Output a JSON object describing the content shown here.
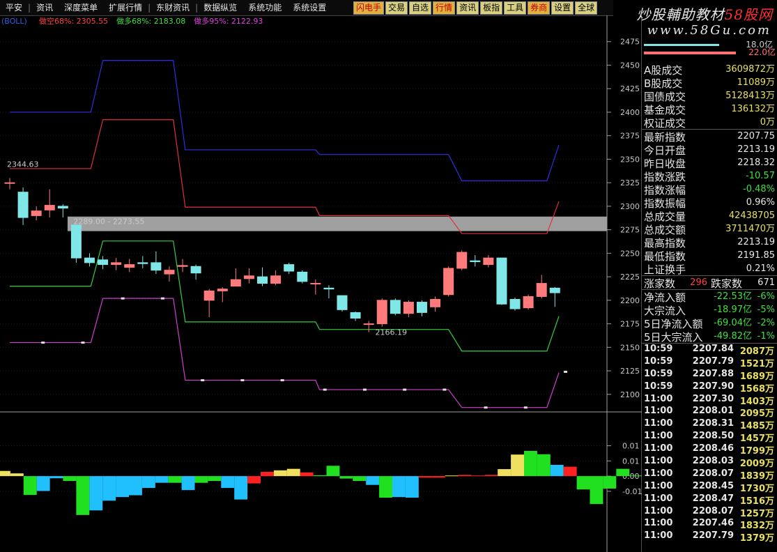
{
  "menu": {
    "items": [
      "平安",
      "资讯",
      "深度菜单",
      "扩展行情",
      "东财资讯",
      "数据纵览",
      "系统功能",
      "系统设置"
    ],
    "buttons": [
      "闪电手",
      "交易",
      "自选",
      "行情",
      "资讯",
      "板指",
      "工具",
      "券商",
      "设置",
      "全球"
    ]
  },
  "logo": {
    "line1_a": "炒股輔助教材",
    "line1_b": "58股网",
    "line2": "www.58Gu.com"
  },
  "legend": {
    "prefix": "(BOLL)",
    "items": [
      {
        "label": "做空68%: 2305.55",
        "color": "#ff4040"
      },
      {
        "label": "做多68%: 2183.08",
        "color": "#40e040"
      },
      {
        "label": "做多95%: 2122.93",
        "color": "#e040e0"
      }
    ]
  },
  "chart_data": [
    {
      "type": "candlestick",
      "title": "",
      "ylim": [
        2088,
        2500
      ],
      "yticks": [
        2100,
        2125,
        2150,
        2175,
        2200,
        2225,
        2250,
        2275,
        2300,
        2325,
        2350,
        2375,
        2400,
        2425,
        2450,
        2475
      ],
      "candles": [
        {
          "o": 2325,
          "c": 2325,
          "h": 2330,
          "l": 2318
        },
        {
          "o": 2315,
          "c": 2288,
          "h": 2320,
          "l": 2280
        },
        {
          "o": 2290,
          "c": 2295,
          "h": 2300,
          "l": 2285
        },
        {
          "o": 2296,
          "c": 2301,
          "h": 2318,
          "l": 2288
        },
        {
          "o": 2300,
          "c": 2298,
          "h": 2302,
          "l": 2288
        },
        {
          "o": 2280,
          "c": 2245,
          "h": 2280,
          "l": 2240
        },
        {
          "o": 2245,
          "c": 2240,
          "h": 2250,
          "l": 2236
        },
        {
          "o": 2243,
          "c": 2238,
          "h": 2247,
          "l": 2233
        },
        {
          "o": 2238,
          "c": 2240,
          "h": 2245,
          "l": 2232
        },
        {
          "o": 2235,
          "c": 2238,
          "h": 2244,
          "l": 2230
        },
        {
          "o": 2240,
          "c": 2239,
          "h": 2247,
          "l": 2234
        },
        {
          "o": 2240,
          "c": 2232,
          "h": 2252,
          "l": 2228
        },
        {
          "o": 2228,
          "c": 2232,
          "h": 2236,
          "l": 2220
        },
        {
          "o": 2236,
          "c": 2237,
          "h": 2244,
          "l": 2230
        },
        {
          "o": 2236,
          "c": 2229,
          "h": 2238,
          "l": 2222
        },
        {
          "o": 2200,
          "c": 2210,
          "h": 2212,
          "l": 2182
        },
        {
          "o": 2210,
          "c": 2212,
          "h": 2214,
          "l": 2198
        },
        {
          "o": 2215,
          "c": 2222,
          "h": 2234,
          "l": 2215
        },
        {
          "o": 2223,
          "c": 2226,
          "h": 2234,
          "l": 2218
        },
        {
          "o": 2225,
          "c": 2218,
          "h": 2235,
          "l": 2215
        },
        {
          "o": 2218,
          "c": 2226,
          "h": 2232,
          "l": 2216
        },
        {
          "o": 2238,
          "c": 2231,
          "h": 2240,
          "l": 2228
        },
        {
          "o": 2230,
          "c": 2220,
          "h": 2232,
          "l": 2218
        },
        {
          "o": 2218,
          "c": 2218,
          "h": 2222,
          "l": 2206
        },
        {
          "o": 2213,
          "c": 2212,
          "h": 2216,
          "l": 2202
        },
        {
          "o": 2205,
          "c": 2190,
          "h": 2205,
          "l": 2188
        },
        {
          "o": 2187,
          "c": 2181,
          "h": 2188,
          "l": 2178
        },
        {
          "o": 2175,
          "c": 2175,
          "h": 2178,
          "l": 2166
        },
        {
          "o": 2175,
          "c": 2200,
          "h": 2202,
          "l": 2172
        },
        {
          "o": 2200,
          "c": 2186,
          "h": 2202,
          "l": 2184
        },
        {
          "o": 2186,
          "c": 2198,
          "h": 2200,
          "l": 2182
        },
        {
          "o": 2198,
          "c": 2187,
          "h": 2200,
          "l": 2183
        },
        {
          "o": 2193,
          "c": 2201,
          "h": 2204,
          "l": 2188
        },
        {
          "o": 2206,
          "c": 2234,
          "h": 2236,
          "l": 2204
        },
        {
          "o": 2234,
          "c": 2251,
          "h": 2253,
          "l": 2232
        },
        {
          "o": 2242,
          "c": 2241,
          "h": 2248,
          "l": 2236
        },
        {
          "o": 2238,
          "c": 2245,
          "h": 2248,
          "l": 2235
        },
        {
          "o": 2245,
          "c": 2196,
          "h": 2245,
          "l": 2195
        },
        {
          "o": 2201,
          "c": 2191,
          "h": 2203,
          "l": 2189
        },
        {
          "o": 2192,
          "c": 2204,
          "h": 2206,
          "l": 2190
        },
        {
          "o": 2204,
          "c": 2218,
          "h": 2227,
          "l": 2202
        },
        {
          "o": 2213,
          "c": 2208,
          "h": 2214,
          "l": 2193
        }
      ],
      "lines": [
        {
          "name": "做空95%",
          "color": "#3030e0",
          "x": [
            0,
            6.1,
            7,
            12.3,
            13.2,
            23,
            23.3,
            33,
            34,
            40.4,
            41.3
          ],
          "y": [
            2400,
            2400,
            2455,
            2455,
            2360,
            2360,
            2355,
            2355,
            2327,
            2327,
            2365
          ]
        },
        {
          "name": "做空68%",
          "color": "#e03040",
          "x": [
            0,
            6.1,
            7,
            12.3,
            13.2,
            23,
            23.3,
            33,
            34,
            40.4,
            41.3
          ],
          "y": [
            2340,
            2340,
            2392,
            2392,
            2299,
            2299,
            2290,
            2290,
            2271,
            2271,
            2305
          ]
        },
        {
          "name": "做多68%",
          "color": "#30d040",
          "x": [
            0,
            6.1,
            7,
            12.3,
            13.2,
            23,
            23.3,
            33,
            34,
            40.4,
            41.3
          ],
          "y": [
            2215,
            2215,
            2263,
            2263,
            2177,
            2177,
            2169,
            2169,
            2146,
            2146,
            2183
          ]
        },
        {
          "name": "做多95%",
          "color": "#d040d0",
          "x": [
            0,
            6.1,
            7,
            12.3,
            13.2,
            23,
            23.3,
            33,
            34,
            40.4,
            41.3
          ],
          "y": [
            2155,
            2155,
            2202,
            2202,
            2115,
            2115,
            2105,
            2105,
            2086,
            2086,
            2123
          ]
        }
      ],
      "annotations": [
        {
          "text": "2344.63",
          "x": 0,
          "y": 2344.63
        },
        {
          "text": "2289.00 - 2273.55",
          "x": 5,
          "y": 2284
        },
        {
          "text": "2166.19",
          "x": 27.7,
          "y": 2166.19
        }
      ],
      "band": {
        "from": 2273.55,
        "to": 2289.0,
        "color": "#a0a0a0"
      }
    },
    {
      "type": "bar",
      "title": "",
      "ylim": [
        -0.025,
        0.02
      ],
      "yticks": [
        {
          "v": 0.01,
          "label": "0.01"
        },
        {
          "v": 0.005,
          "label": "0.01"
        },
        {
          "v": 0.0,
          "label": "0.00"
        },
        {
          "v": -0.005,
          "label": "-0.01"
        }
      ],
      "values": [
        0.0017,
        0.0009,
        -0.0062,
        -0.0049,
        -0.0007,
        -0.0016,
        -0.0128,
        -0.0113,
        -0.0081,
        -0.0069,
        -0.0063,
        -0.0039,
        -0.0022,
        -0.0022,
        -0.0046,
        -0.0022,
        -0.0016,
        -0.0039,
        -0.0077,
        -0.0024,
        0.0014,
        0.0019,
        0.0024,
        0.0012,
        0.0003,
        0.0034,
        -0.0008,
        -0.0016,
        -0.0029,
        -0.0071,
        -0.0069,
        -0.0071,
        -0.0005,
        -0.0005,
        0.0002,
        0.0004,
        0.0002,
        0.0004,
        0.0023,
        0.0071,
        0.0083,
        0.0072,
        0.0037,
        0.0031,
        -0.0044,
        -0.0092,
        -0.0041,
        0.0024,
        0.0002
      ],
      "colors": [
        "#f0e060",
        "#f0e060",
        "#20e020",
        "#20c0ff",
        "#20c0ff",
        "#20e020",
        "#20e020",
        "#20c0ff",
        "#20c0ff",
        "#20c0ff",
        "#20c0ff",
        "#20c0ff",
        "#20c0ff",
        "#20e020",
        "#20c0ff",
        "#20e020",
        "#20e020",
        "#20c0ff",
        "#20c0ff",
        "#ff2020",
        "#ff2020",
        "#f0e060",
        "#f0e060",
        "#ff2020",
        "#20e020",
        "#20e020",
        "#20e020",
        "#20e020",
        "#20c0ff",
        "#20e020",
        "#20c0ff",
        "#20c0ff",
        "#ff2020",
        "#ff2020",
        "#f0e060",
        "#ff2020",
        "#ff2020",
        "#ff2020",
        "#f0e060",
        "#f0e060",
        "#20e020",
        "#20e020",
        "#20c0ff",
        "#ff2020",
        "#20e020",
        "#20e020",
        "#20e020",
        "#20e020",
        "#20e020"
      ]
    }
  ],
  "panel": {
    "top_values": [
      "18.0亿",
      "22.0亿"
    ],
    "stats": [
      {
        "k": "A股成交",
        "v": "3609872万",
        "c": "#e8e060"
      },
      {
        "k": "B股成交",
        "v": "11089万",
        "c": "#e8e060"
      },
      {
        "k": "国债成交",
        "v": "5128413万",
        "c": "#e8e060"
      },
      {
        "k": "基金成交",
        "v": "136132万",
        "c": "#e8e060"
      },
      {
        "k": "权证成交",
        "v": "0万",
        "c": "#e8e060"
      },
      {
        "k": "最新指数",
        "v": "2207.75",
        "c": "#e8e8e8"
      },
      {
        "k": "今日开盘",
        "v": "2213.19",
        "c": "#e8e8e8"
      },
      {
        "k": "昨日收盘",
        "v": "2218.32",
        "c": "#e8e8e8"
      },
      {
        "k": "指数涨跌",
        "v": "-10.57",
        "c": "#40e040"
      },
      {
        "k": "指数涨幅",
        "v": "-0.48%",
        "c": "#40e040"
      },
      {
        "k": "指数振幅",
        "v": "0.96%",
        "c": "#e8e8e8"
      },
      {
        "k": "总成交量",
        "v": "42438705",
        "c": "#e8e060"
      },
      {
        "k": "总成交额",
        "v": "3711470万",
        "c": "#e8e060"
      },
      {
        "k": "最高指数",
        "v": "2213.19",
        "c": "#e8e8e8"
      },
      {
        "k": "最低指数",
        "v": "2191.85",
        "c": "#e8e8e8"
      },
      {
        "k": "上证换手",
        "v": "0.21%",
        "c": "#e8e8e8"
      }
    ],
    "up_label": "涨家数",
    "up_value": "296",
    "down_label": "跌家数",
    "down_value": "671",
    "flows": [
      {
        "k": "净流入额",
        "v": "-22.53亿",
        "p": "-6%"
      },
      {
        "k": "大宗流入",
        "v": "-18.97亿",
        "p": "-5%"
      },
      {
        "k": "5日净流入额",
        "v": "-69.04亿",
        "p": "-2%"
      },
      {
        "k": "5日大宗流入",
        "v": "-49.82亿",
        "p": "-1%"
      }
    ],
    "ticks": [
      {
        "t": "10:59",
        "p": "2207.84",
        "v": "2087万"
      },
      {
        "t": "10:59",
        "p": "2207.79",
        "v": "1521万"
      },
      {
        "t": "10:59",
        "p": "2207.88",
        "v": "1689万"
      },
      {
        "t": "10:59",
        "p": "2207.90",
        "v": "1568万"
      },
      {
        "t": "11:00",
        "p": "2207.30",
        "v": "1403万"
      },
      {
        "t": "11:00",
        "p": "2208.01",
        "v": "2095万"
      },
      {
        "t": "11:00",
        "p": "2208.31",
        "v": "1485万"
      },
      {
        "t": "11:00",
        "p": "2208.50",
        "v": "1457万"
      },
      {
        "t": "11:00",
        "p": "2208.46",
        "v": "1799万"
      },
      {
        "t": "11:00",
        "p": "2208.03",
        "v": "2009万"
      },
      {
        "t": "11:00",
        "p": "2208.07",
        "v": "1839万"
      },
      {
        "t": "11:00",
        "p": "2208.45",
        "v": "1730万"
      },
      {
        "t": "11:00",
        "p": "2208.47",
        "v": "1516万"
      },
      {
        "t": "11:00",
        "p": "2208.07",
        "v": "1257万"
      },
      {
        "t": "11:00",
        "p": "2207.46",
        "v": "1832万"
      },
      {
        "t": "11:00",
        "p": "2207.79",
        "v": "1379万"
      }
    ]
  }
}
